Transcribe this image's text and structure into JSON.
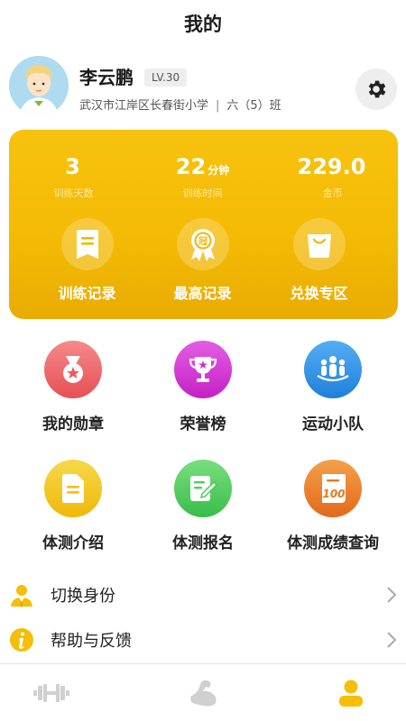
{
  "header": {
    "title": "我的"
  },
  "profile": {
    "name": "李云鹏",
    "level": "LV.30",
    "school": "武汉市江岸区长春街小学",
    "separator": "|",
    "class_name": "六（5）班"
  },
  "stats": [
    {
      "value": "3",
      "unit": "",
      "label": "训练天数"
    },
    {
      "value": "22",
      "unit": "分钟",
      "label": "训练时间"
    },
    {
      "value": "229.0",
      "unit": "",
      "label": "金币"
    }
  ],
  "quick_actions": [
    {
      "label": "训练记录",
      "icon": "document-icon"
    },
    {
      "label": "最高记录",
      "icon": "medal-icon"
    },
    {
      "label": "兑换专区",
      "icon": "shopping-bag-icon"
    }
  ],
  "grid": [
    {
      "label": "我的勋章",
      "icon": "medal-icon",
      "color": "#ec5a5a"
    },
    {
      "label": "荣誉榜",
      "icon": "trophy-icon",
      "color": "#cf2dcf"
    },
    {
      "label": "运动小队",
      "icon": "team-icon",
      "color": "#2f8ee8"
    },
    {
      "label": "体测介绍",
      "icon": "document-icon",
      "color": "#f2c20f"
    },
    {
      "label": "体测报名",
      "icon": "edit-icon",
      "color": "#4ccb5a"
    },
    {
      "label": "体测成绩查询",
      "icon": "score-100-icon",
      "color": "#e9781f"
    }
  ],
  "menu": [
    {
      "label": "切换身份",
      "icon": "user-switch-icon"
    },
    {
      "label": "帮助与反馈",
      "icon": "info-icon"
    }
  ],
  "tabs": [
    {
      "name": "training",
      "icon": "dumbbell-icon",
      "active": false
    },
    {
      "name": "sport",
      "icon": "arm-icon",
      "active": false
    },
    {
      "name": "mine",
      "icon": "user-icon",
      "active": true
    }
  ],
  "colors": {
    "accent": "#f5be07",
    "inactive_tab": "#d0d0d0"
  }
}
